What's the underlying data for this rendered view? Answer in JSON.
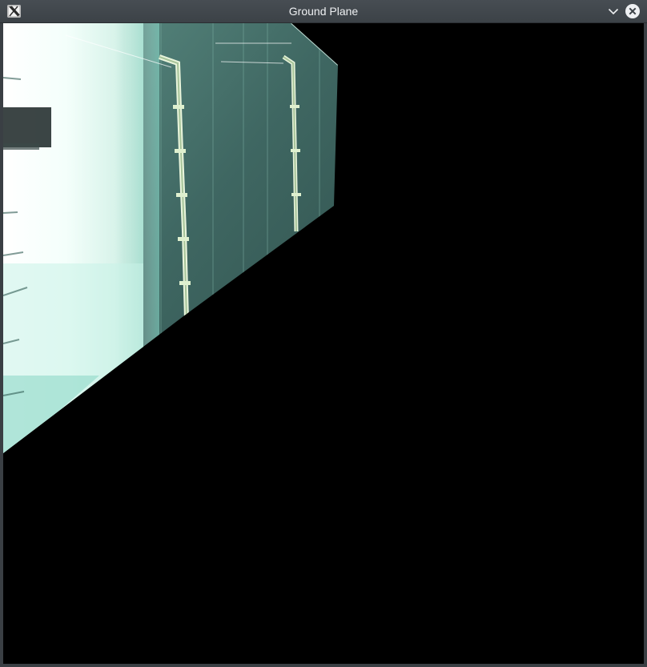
{
  "window": {
    "title": "Ground Plane",
    "app_icon": "x11-icon",
    "controls": {
      "minimize_icon": "chevron-down-icon",
      "close_icon": "close-icon"
    }
  },
  "viewport": {
    "content": "warped-ground-plane-image",
    "background_color": "#000000"
  }
}
